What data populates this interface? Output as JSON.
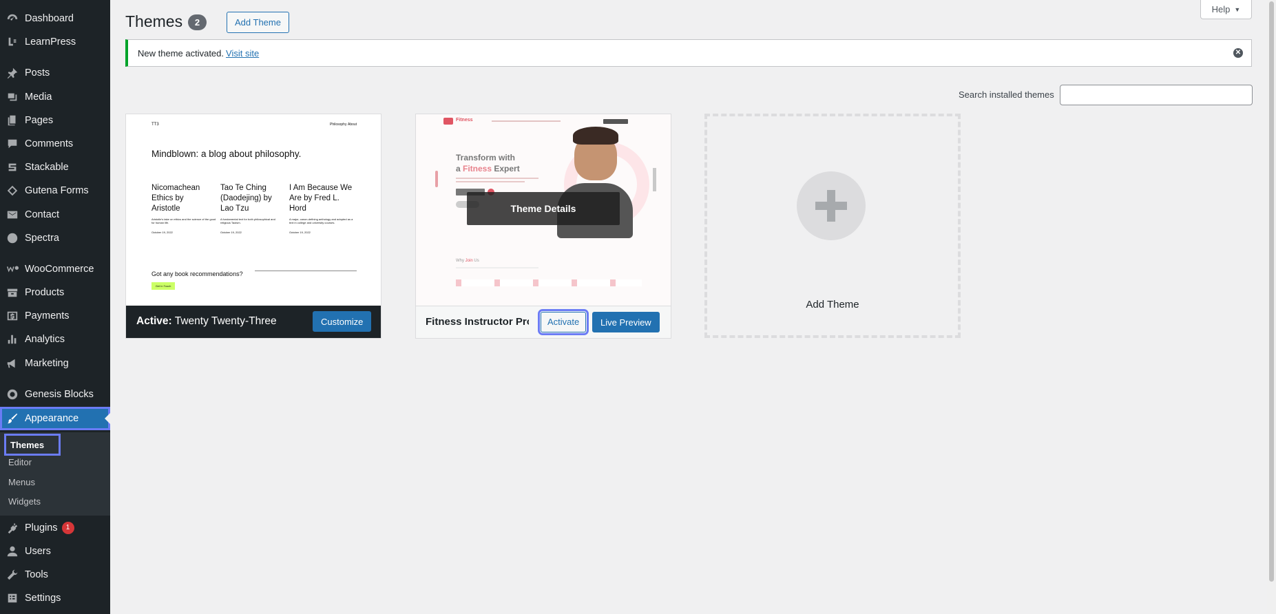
{
  "sidebar": {
    "items": [
      {
        "label": "Dashboard",
        "icon": "dashboard-icon"
      },
      {
        "label": "LearnPress",
        "icon": "learnpress-icon"
      },
      {
        "label": "Posts",
        "icon": "pushpin-icon"
      },
      {
        "label": "Media",
        "icon": "media-icon"
      },
      {
        "label": "Pages",
        "icon": "pages-icon"
      },
      {
        "label": "Comments",
        "icon": "comment-icon"
      },
      {
        "label": "Stackable",
        "icon": "stackable-icon"
      },
      {
        "label": "Gutena Forms",
        "icon": "gutena-icon"
      },
      {
        "label": "Contact",
        "icon": "mail-icon"
      },
      {
        "label": "Spectra",
        "icon": "spectra-icon"
      },
      {
        "label": "WooCommerce",
        "icon": "woocommerce-icon"
      },
      {
        "label": "Products",
        "icon": "archive-icon"
      },
      {
        "label": "Payments",
        "icon": "dollar-icon"
      },
      {
        "label": "Analytics",
        "icon": "bar-chart-icon"
      },
      {
        "label": "Marketing",
        "icon": "megaphone-icon"
      },
      {
        "label": "Genesis Blocks",
        "icon": "genesis-icon"
      },
      {
        "label": "Appearance",
        "icon": "paintbrush-icon"
      },
      {
        "label": "Plugins",
        "icon": "plugin-icon",
        "badge": "1"
      },
      {
        "label": "Users",
        "icon": "user-icon"
      },
      {
        "label": "Tools",
        "icon": "wrench-icon"
      },
      {
        "label": "Settings",
        "icon": "settings-icon"
      }
    ],
    "submenu": [
      "Themes",
      "Editor",
      "Menus",
      "Widgets"
    ]
  },
  "header": {
    "title": "Themes",
    "count": "2",
    "add_theme": "Add Theme",
    "help": "Help",
    "help_arrow": "▼"
  },
  "notice": {
    "text": "New theme activated.",
    "link": "Visit site"
  },
  "search": {
    "label": "Search installed themes",
    "value": ""
  },
  "themes": [
    {
      "active_prefix": "Active:",
      "name": "Twenty Twenty-Three",
      "customize": "Customize",
      "preview": {
        "logo": "TT3",
        "nav": [
          "Philosophy",
          "About"
        ],
        "heading": "Mindblown: a blog about philosophy.",
        "posts": [
          {
            "title": "Nicomachean Ethics by Aristotle",
            "excerpt": "Aristotle's take on ethics and the science of the good for human life.",
            "date": "October 19, 2022"
          },
          {
            "title": "Tao Te Ching (Daodejing) by Lao Tzu",
            "excerpt": "A fundamental text for both philosophical and religious Taoism.",
            "date": "October 19, 2022"
          },
          {
            "title": "I Am Because We Are by Fred L. Hord",
            "excerpt": "A major, canon-defining anthology and adopted as a text in college and university courses.",
            "date": "October 19, 2022"
          }
        ],
        "cta": "Got any book recommendations?",
        "cta_button": "Get In Touch"
      }
    },
    {
      "name": "Fitness Instructor Pro",
      "details": "Theme Details",
      "activate": "Activate",
      "live_preview": "Live Preview",
      "preview": {
        "brand": "Fitness",
        "hero_line1": "Transform with",
        "hero_line2a": "a ",
        "hero_line2b": "Fitness",
        "hero_line2c": " Expert",
        "section": "Why ",
        "section_highlight": "Join",
        "section_end": " Us"
      }
    }
  ],
  "add_new": {
    "label": "Add Theme"
  },
  "colors": {
    "sidebar_bg": "#1d2327",
    "accent": "#2271b1",
    "notice_success": "#00a32a",
    "focus_ring": "#6b7cf5",
    "badge": "#d63638"
  }
}
